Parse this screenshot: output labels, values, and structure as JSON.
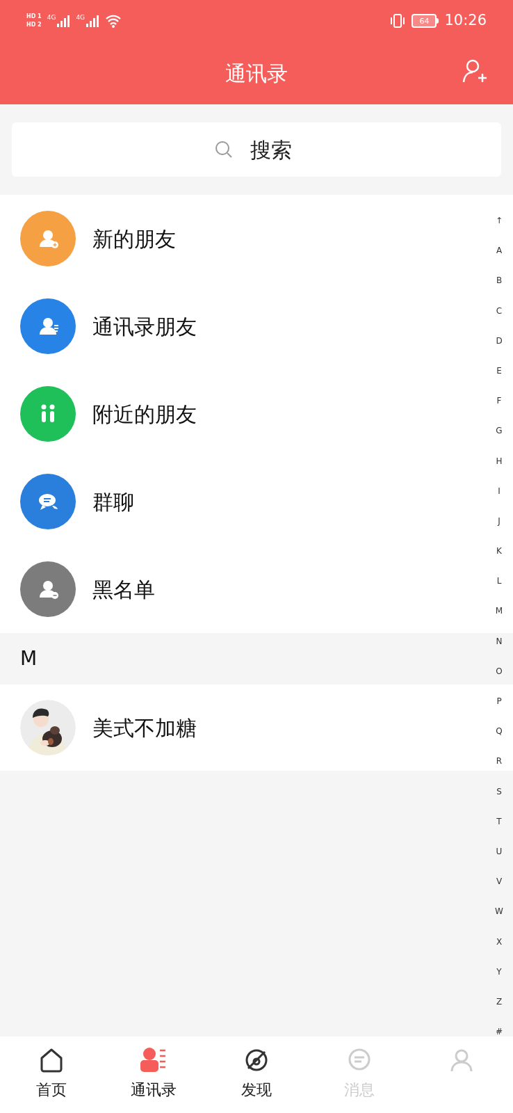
{
  "status_bar": {
    "sim_labels": [
      "HD 1",
      "HD 2"
    ],
    "network": [
      "4G",
      "4G"
    ],
    "battery": "64",
    "time": "10:26"
  },
  "header": {
    "title": "通讯录"
  },
  "search": {
    "placeholder": "搜索"
  },
  "entries": [
    {
      "kind": "new-friends",
      "label": "新的朋友",
      "color": "#f5a043"
    },
    {
      "kind": "contacts",
      "label": "通讯录朋友",
      "color": "#2783e6"
    },
    {
      "kind": "nearby",
      "label": "附近的朋友",
      "color": "#1fbf5a"
    },
    {
      "kind": "groups",
      "label": "群聊",
      "color": "#2a7fdc"
    },
    {
      "kind": "blacklist",
      "label": "黑名单",
      "color": "#7c7c7c"
    }
  ],
  "sections": [
    {
      "letter": "M",
      "contacts": [
        {
          "name": "美式不加糖"
        }
      ]
    }
  ],
  "index_bar": [
    "↑",
    "A",
    "B",
    "C",
    "D",
    "E",
    "F",
    "G",
    "H",
    "I",
    "J",
    "K",
    "L",
    "M",
    "N",
    "O",
    "P",
    "Q",
    "R",
    "S",
    "T",
    "U",
    "V",
    "W",
    "X",
    "Y",
    "Z",
    "#"
  ],
  "tabs": [
    {
      "kind": "home",
      "label": "首页",
      "selected": false
    },
    {
      "kind": "contacts",
      "label": "通讯录",
      "selected": true
    },
    {
      "kind": "discover",
      "label": "发现",
      "selected": false
    },
    {
      "kind": "messages",
      "label": "消息",
      "selected": false
    },
    {
      "kind": "profile",
      "selected": false
    }
  ]
}
